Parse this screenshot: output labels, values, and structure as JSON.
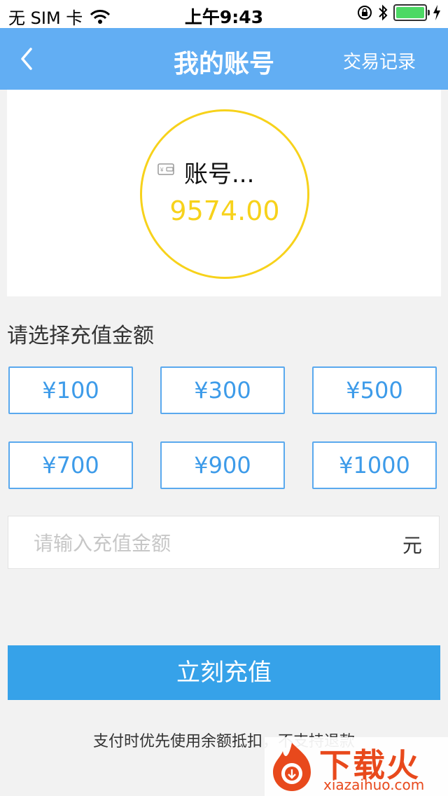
{
  "status_bar": {
    "carrier": "无 SIM 卡",
    "time": "上午9:43"
  },
  "nav": {
    "title": "我的账号",
    "right_action": "交易记录"
  },
  "balance": {
    "account_label": "账号...",
    "amount": "9574.00"
  },
  "recharge": {
    "section_title": "请选择充值金额",
    "options": [
      "¥100",
      "¥300",
      "¥500",
      "¥700",
      "¥900",
      "¥1000"
    ],
    "input_placeholder": "请输入充值金额",
    "input_value": "",
    "unit": "元",
    "submit_label": "立刻充值"
  },
  "footer": {
    "note": "支付时优先使用余额抵扣，不支持退款"
  },
  "watermark": {
    "brand": "下载火",
    "domain": "xiazaihuo.com"
  },
  "colors": {
    "nav_bg": "#62aef3",
    "accent_yellow": "#f7d21b",
    "option_blue": "#3d9be9",
    "button_blue": "#36a2e9"
  },
  "icons": {
    "back": "chevron-left-icon",
    "wallet": "wallet-icon",
    "wifi": "wifi-icon",
    "lock": "rotation-lock-icon",
    "bluetooth": "bluetooth-icon",
    "battery": "battery-icon",
    "charging": "charging-bolt-icon"
  }
}
